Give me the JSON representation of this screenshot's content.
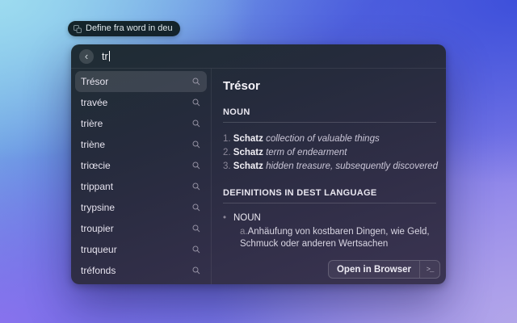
{
  "background": {
    "top_left": "#9edcf0",
    "top_right": "#3b4eda",
    "bottom_left": "#8a72ee",
    "bottom_right": "#b2a6e9"
  },
  "pill": {
    "label": "Define fra word in deu"
  },
  "search": {
    "value": "tr",
    "back_icon": "‹"
  },
  "words": {
    "items": [
      {
        "label": "Trésor",
        "selected": true
      },
      {
        "label": "travée"
      },
      {
        "label": "trière"
      },
      {
        "label": "triène"
      },
      {
        "label": "triœcie"
      },
      {
        "label": "trippant"
      },
      {
        "label": "trypsine"
      },
      {
        "label": "troupier"
      },
      {
        "label": "truqueur"
      },
      {
        "label": "tréfonds"
      }
    ]
  },
  "detail": {
    "title": "Trésor",
    "noun_heading": "NOUN",
    "noun_entries": [
      {
        "num": "1.",
        "term": "Schatz",
        "definition": "collection of valuable things"
      },
      {
        "num": "2.",
        "term": "Schatz",
        "definition": "term of endearment"
      },
      {
        "num": "3.",
        "term": "Schatz",
        "definition": "hidden treasure, subsequently discovered"
      }
    ],
    "dest_heading": "DEFINITIONS IN DEST LANGUAGE",
    "dest_bullet": "•",
    "dest_pos": "NOUN",
    "dest_entry": {
      "letter": "a.",
      "text": "Anhäufung von kostbaren Dingen, wie Geld, Schmuck oder anderen Wertsachen"
    }
  },
  "footer": {
    "open_in_browser": "Open in Browser",
    "shortcut": ">_"
  },
  "colors": {
    "panel_top": "#1e2c33",
    "panel_bottom": "#3b3452",
    "selected_row_bg": "rgba(255,255,255,0.12)"
  }
}
